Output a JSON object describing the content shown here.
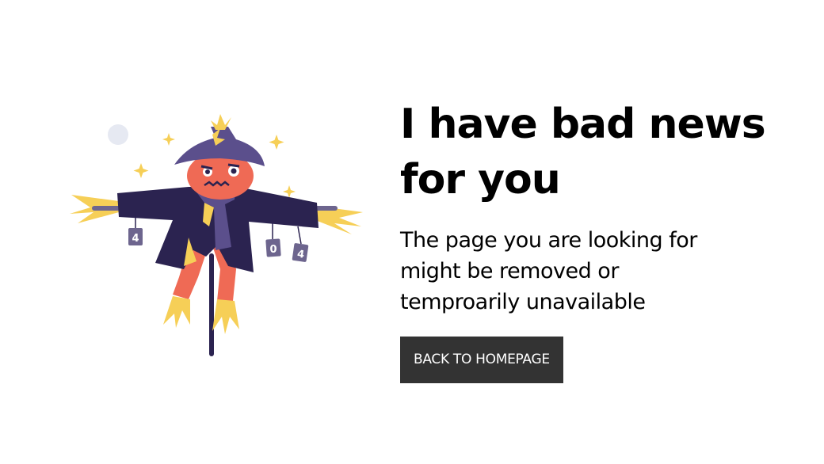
{
  "error_page": {
    "headline": "I have bad news for you",
    "message": "The page you are looking for might be removed or temproarily unavailable",
    "button_label": "BACK TO HOMEPAGE",
    "illustration": {
      "icon": "scarecrow-404-illustration",
      "left_tag": "4",
      "right_tags": [
        "0",
        "4"
      ]
    },
    "colors": {
      "button_bg": "#333333",
      "button_text": "#ffffff",
      "coat": "#2b2350",
      "hat": "#5b4f8c",
      "face": "#ef6a55",
      "straw": "#f6cf57"
    }
  }
}
